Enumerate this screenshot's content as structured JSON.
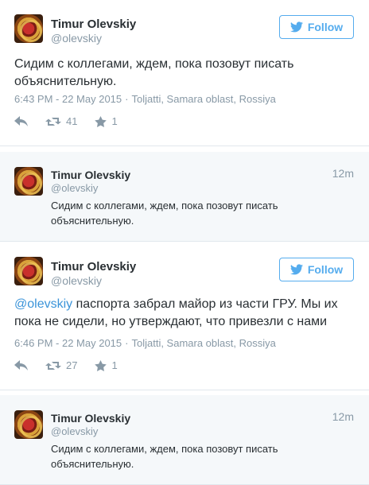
{
  "tweets": [
    {
      "name": "Timur Olevskiy",
      "handle": "@olevskiy",
      "follow_label": "Follow",
      "text": "Сидим с коллегами, ждем, пока позовут писать объяснительную.",
      "timestamp": "6:43 PM - 22 May 2015",
      "separator": "·",
      "location": "Toljatti, Samara oblast, Rossiya",
      "retweets": "41",
      "favorites": "1"
    },
    {
      "name": "Timur Olevskiy",
      "handle": "@olevskiy",
      "follow_label": "Follow",
      "mention": "@olevskiy",
      "text_line1": " паспорта забрал майор из части ГРУ. Мы их",
      "text_line2": "пока не сидели, но утверждают, что привезли с нами",
      "timestamp": "6:46 PM - 22 May 2015",
      "separator": "·",
      "location": "Toljatti, Samara oblast, Rossiya",
      "retweets": "27",
      "favorites": "1"
    }
  ],
  "quoted": [
    {
      "name": "Timur Olevskiy",
      "handle": "@olevskiy",
      "time": "12m",
      "text": "Сидим с коллегами, ждем, пока позовут писать объяснительную."
    },
    {
      "name": "Timur Olevskiy",
      "handle": "@olevskiy",
      "time": "12m",
      "text": "Сидим с коллегами, ждем, пока позовут писать объяснительную."
    }
  ],
  "icons": {
    "bird": "twitter-bird-icon",
    "reply": "reply-icon",
    "retweet": "retweet-icon",
    "favorite": "star-icon"
  },
  "colors": {
    "accent": "#55acee",
    "muted": "#8899a6",
    "quoted_bg": "#f5f8fa"
  }
}
